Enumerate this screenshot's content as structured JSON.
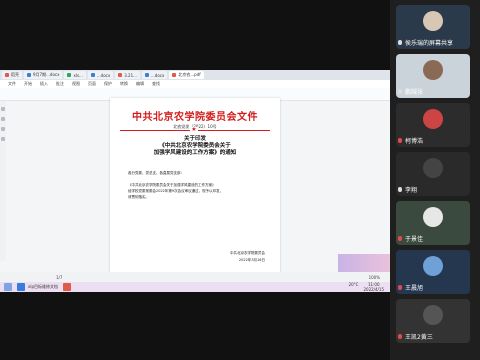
{
  "tabs": [
    {
      "label": "稻壳",
      "color": "#e05a47",
      "active": false
    },
    {
      "label": "9月7期...docx",
      "color": "#3d7de0",
      "active": false
    },
    {
      "label": "xls...",
      "color": "#2ea655",
      "active": false
    },
    {
      "label": "...docx",
      "color": "#3d7de0",
      "active": false
    },
    {
      "label": "3.21...",
      "color": "#e05a47",
      "active": false
    },
    {
      "label": "...docx",
      "color": "#3d7de0",
      "active": false
    },
    {
      "label": "北京农...pdf",
      "color": "#e05a47",
      "active": true
    }
  ],
  "menu": [
    "文件",
    "开始",
    "插入",
    "批注",
    "视图",
    "页面",
    "保护",
    "转换",
    "编辑",
    "查找"
  ],
  "document": {
    "title": "中共北京农学院委员会文件",
    "number": "北农党发〔2022〕10号",
    "star": "★",
    "heading": [
      "关于印发",
      "《中共北京农学院委员会关于",
      "加强学风建设的工作方案》的通知"
    ],
    "salute": "各分党委、党总支、各直属党支部：",
    "body": [
      "《中共北京农学院委员会关于加强学风建设的工作方案》",
      "经学校党委常委会2022年第9次会议审议通过，现予以印发，",
      "请贯彻落实。"
    ],
    "sign_org": "中共北京农学院委员会",
    "sign_date": "2022年3月16日"
  },
  "statusbar": {
    "page": "1/7",
    "zoom": "100%"
  },
  "taskbar": {
    "app_label": "xlp目标维修文档",
    "temp": "20°C",
    "clock_time": "11:00",
    "clock_date": "2022/4/15"
  },
  "participants": [
    {
      "name": "侯乐瑞的屏幕共享",
      "mic": "on",
      "cam_color": "#2b3a4a"
    },
    {
      "name": "鹏贼张",
      "mic": "on",
      "cam_color": "#c9d3d9"
    },
    {
      "name": "柯博浩",
      "mic": "off",
      "cam_color": "#2c2c2c"
    },
    {
      "name": "李翔",
      "mic": "on",
      "cam_color": "#2a2a2a"
    },
    {
      "name": "于景佳",
      "mic": "off",
      "cam_color": "#3a4a3f"
    },
    {
      "name": "王晨旭",
      "mic": "off",
      "cam_color": "#25364f"
    },
    {
      "name": "王凯2黄三",
      "mic": "off",
      "cam_color": "#333"
    }
  ]
}
